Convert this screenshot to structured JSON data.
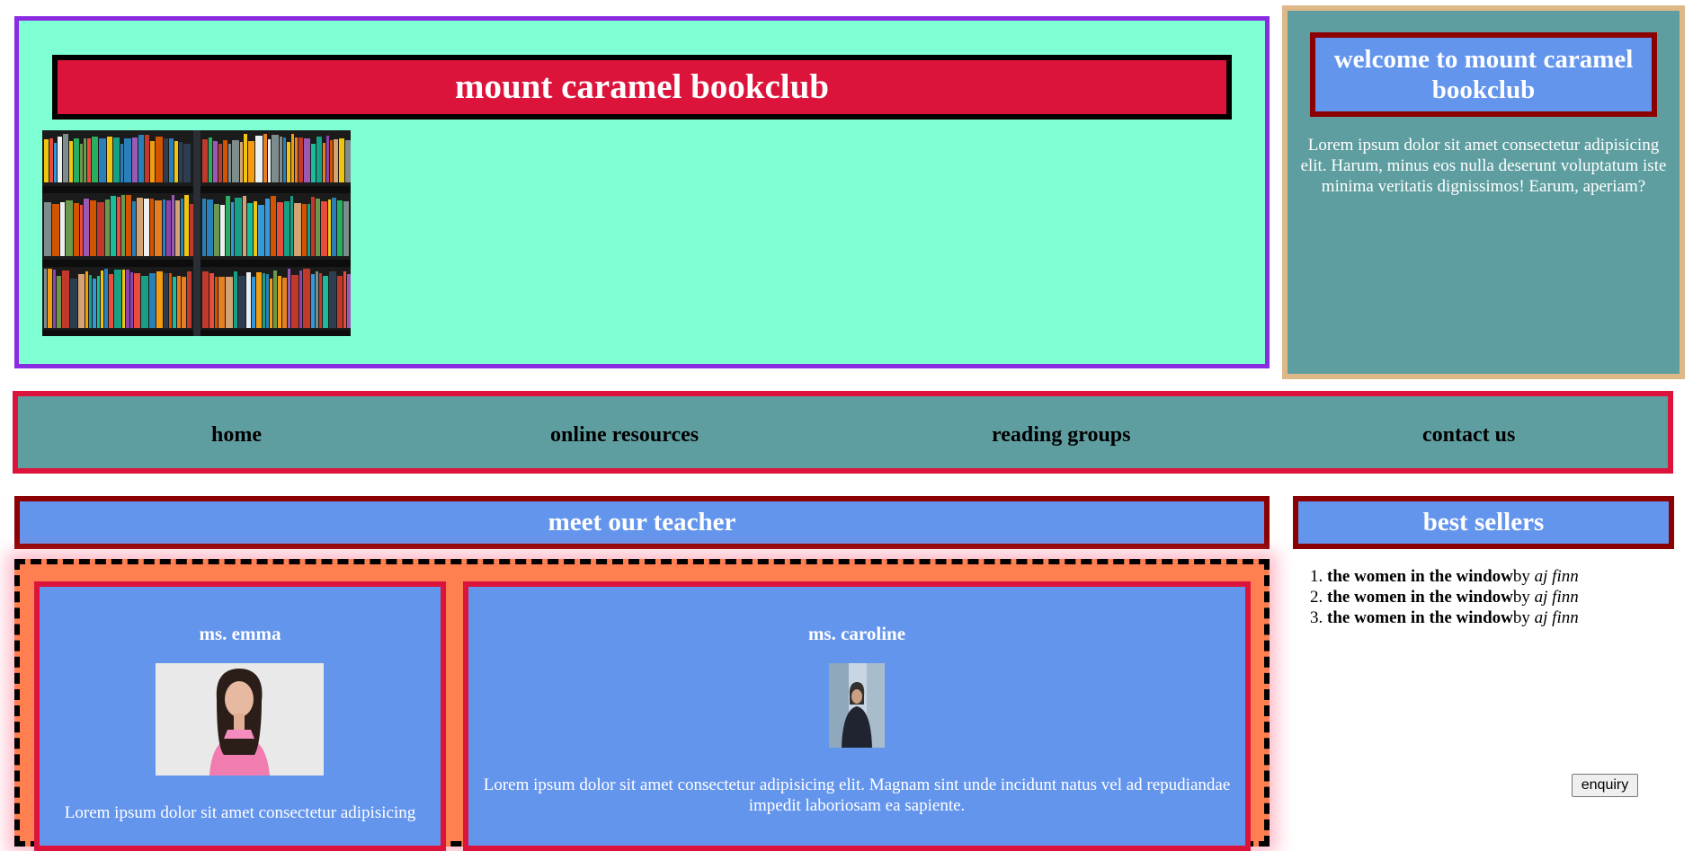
{
  "header": {
    "title": "mount caramel bookclub"
  },
  "welcome": {
    "title": "welcome to mount caramel bookclub",
    "text": "Lorem ipsum dolor sit amet consectetur adipisicing elit. Harum, minus eos nulla deserunt voluptatum iste minima veritatis dignissimos! Earum, aperiam?"
  },
  "nav": {
    "items": [
      {
        "label": "home"
      },
      {
        "label": "online resources"
      },
      {
        "label": "reading groups"
      },
      {
        "label": "contact us"
      }
    ]
  },
  "teachers": {
    "heading": "meet our teacher",
    "cards": [
      {
        "name": "ms. emma",
        "text": "Lorem ipsum dolor sit amet consectetur adipisicing"
      },
      {
        "name": "ms. caroline",
        "text": "Lorem ipsum dolor sit amet consectetur adipisicing elit. Magnam sint unde incidunt natus vel ad repudiandae impedit laboriosam ea sapiente."
      }
    ]
  },
  "bestsellers": {
    "heading": "best sellers",
    "items": [
      {
        "title": "the women in the window",
        "by": "by ",
        "author": "aj finn"
      },
      {
        "title": "the women in the window",
        "by": "by ",
        "author": "aj finn"
      },
      {
        "title": "the women in the window",
        "by": "by ",
        "author": "aj finn"
      }
    ]
  },
  "enquiry": {
    "label": "enquiry"
  },
  "colors": {
    "header_bg": "#7fffd4",
    "header_border": "#8a2be2",
    "title_bg": "#dc143c",
    "panel_bg": "#5f9ea0",
    "panel_border": "#deb887",
    "heading_bg": "#6495ed",
    "heading_border": "#8b0000",
    "nav_border": "#dc143c",
    "teachers_bg": "#ff7f50"
  }
}
